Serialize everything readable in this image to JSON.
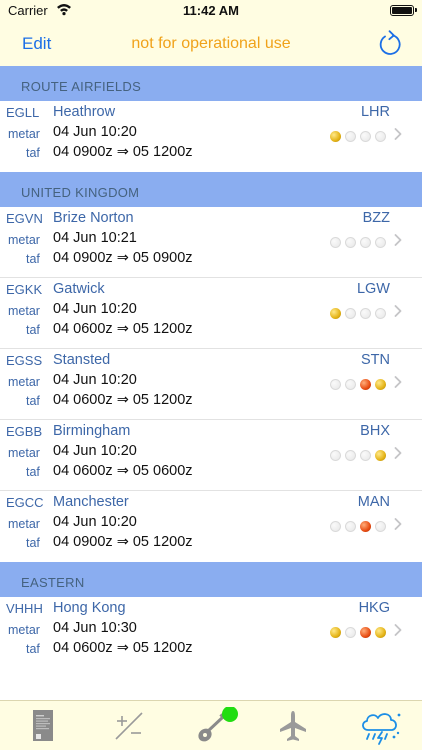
{
  "status_bar": {
    "carrier": "Carrier",
    "time": "11:42 AM"
  },
  "nav": {
    "edit_label": "Edit",
    "title": "not for operational use"
  },
  "sections": [
    {
      "header": "ROUTE AIRFIELDS",
      "rows": [
        {
          "icao": "EGLL",
          "name": "Heathrow",
          "iata": "LHR",
          "metar_label": "metar",
          "metar": "04 Jun 10:20",
          "taf_label": "taf",
          "taf": "04 0900z ⇒ 05 1200z",
          "dots": [
            "amber",
            "empty",
            "empty",
            "empty"
          ]
        }
      ]
    },
    {
      "header": "UNITED KINGDOM",
      "rows": [
        {
          "icao": "EGVN",
          "name": "Brize Norton",
          "iata": "BZZ",
          "metar_label": "metar",
          "metar": "04 Jun 10:21",
          "taf_label": "taf",
          "taf": "04 0900z ⇒ 05 0900z",
          "dots": [
            "empty",
            "empty",
            "empty",
            "empty"
          ]
        },
        {
          "icao": "EGKK",
          "name": "Gatwick",
          "iata": "LGW",
          "metar_label": "metar",
          "metar": "04 Jun 10:20",
          "taf_label": "taf",
          "taf": "04 0600z ⇒ 05 1200z",
          "dots": [
            "amber",
            "empty",
            "empty",
            "empty"
          ]
        },
        {
          "icao": "EGSS",
          "name": "Stansted",
          "iata": "STN",
          "metar_label": "metar",
          "metar": "04 Jun 10:20",
          "taf_label": "taf",
          "taf": "04 0600z ⇒ 05 1200z",
          "dots": [
            "empty",
            "empty",
            "red",
            "amber"
          ]
        },
        {
          "icao": "EGBB",
          "name": "Birmingham",
          "iata": "BHX",
          "metar_label": "metar",
          "metar": "04 Jun 10:20",
          "taf_label": "taf",
          "taf": "04 0600z ⇒ 05 0600z",
          "dots": [
            "empty",
            "empty",
            "empty",
            "amber"
          ]
        },
        {
          "icao": "EGCC",
          "name": "Manchester",
          "iata": "MAN",
          "metar_label": "metar",
          "metar": "04 Jun 10:20",
          "taf_label": "taf",
          "taf": "04 0900z ⇒ 05 1200z",
          "dots": [
            "empty",
            "empty",
            "red",
            "empty"
          ]
        }
      ]
    },
    {
      "header": "EASTERN",
      "rows": [
        {
          "icao": "VHHH",
          "name": "Hong Kong",
          "iata": "HKG",
          "metar_label": "metar",
          "metar": "04 Jun 10:30",
          "taf_label": "taf",
          "taf": "04 0600z ⇒ 05 1200z",
          "dots": [
            "amber",
            "empty",
            "red",
            "amber"
          ]
        }
      ]
    }
  ],
  "tabs": [
    {
      "icon": "document-icon"
    },
    {
      "icon": "plus-minus-icon"
    },
    {
      "icon": "guitar-icon",
      "badge_color": "#22dd11"
    },
    {
      "icon": "airplane-icon"
    },
    {
      "icon": "weather-icon",
      "active": true
    }
  ],
  "colors": {
    "bar_background": "#fffde2",
    "section_header": "#8aadf0",
    "accent_blue": "#1c6fe6",
    "title_orange": "#f0a21a",
    "label_blue": "#3d67a8"
  }
}
